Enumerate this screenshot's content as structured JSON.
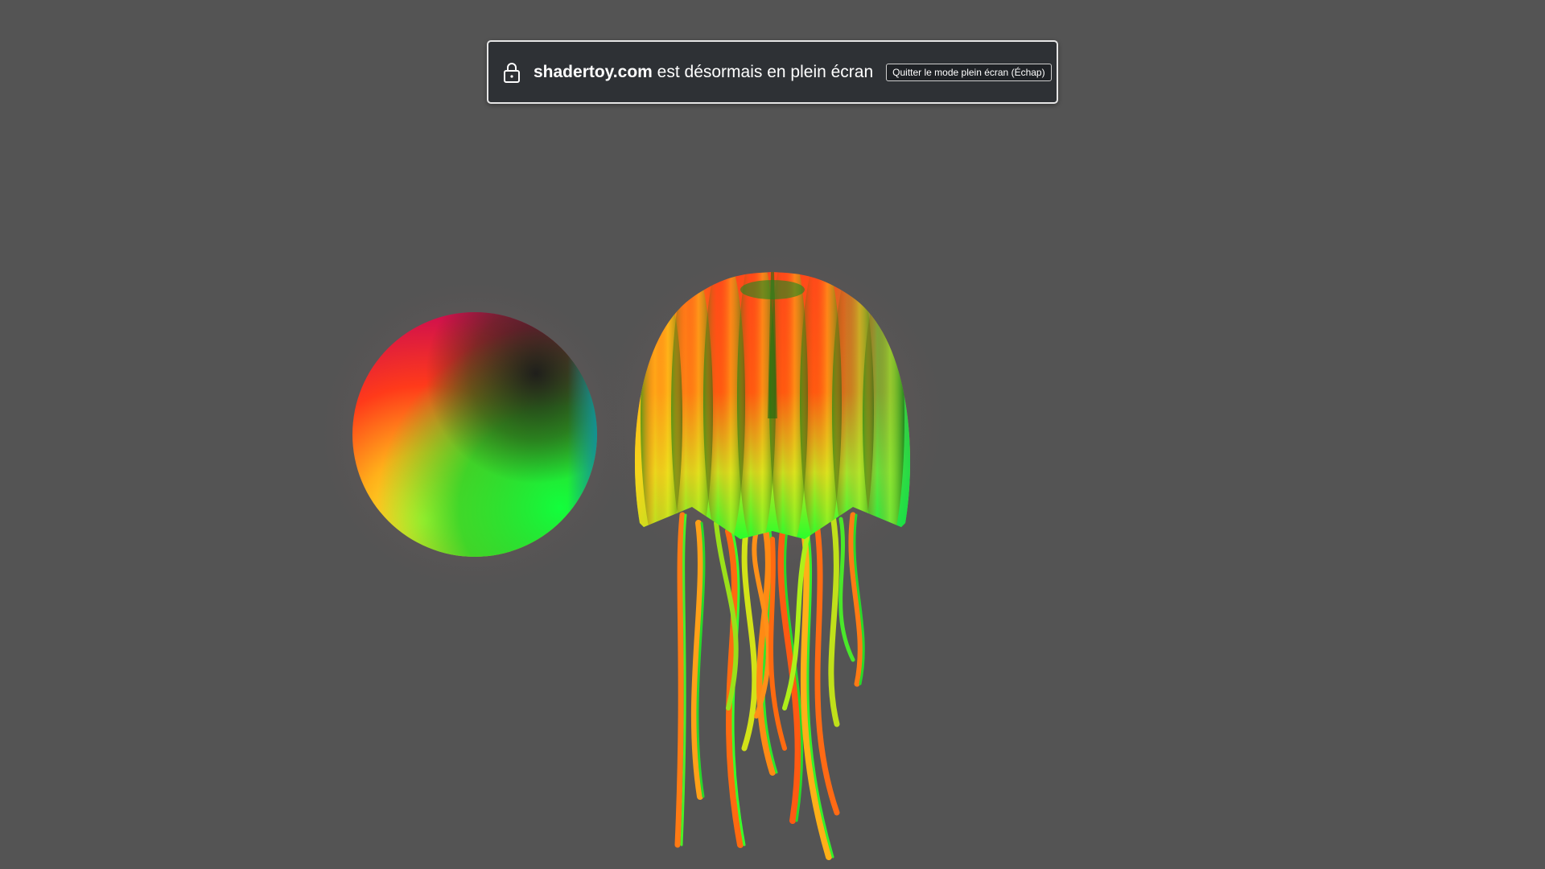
{
  "fullscreen_notice": {
    "host": "shadertoy.com",
    "message": "est désormais en plein écran",
    "exit_button_label": "Quitter le mode plein écran (Échap)",
    "icon": "lock-icon"
  },
  "canvas": {
    "background": "#545454",
    "objects": [
      "sphere",
      "jellyfish"
    ]
  },
  "colors": {
    "banner_bg": "#2e3135",
    "banner_border": "#e6e6e6",
    "accent_red": "#ff2a1a",
    "accent_green": "#2bff2a",
    "accent_yellow": "#f5ff3a",
    "accent_purple": "#4a0a6a"
  }
}
